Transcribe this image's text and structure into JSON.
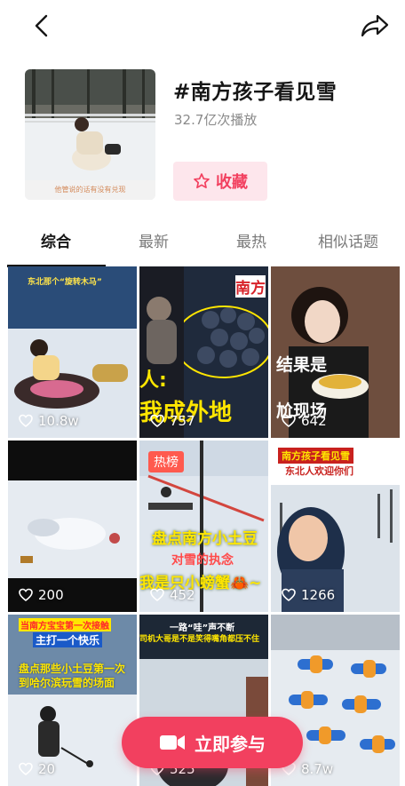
{
  "topic": {
    "title": "#南方孩子看见雪",
    "play_count": "32.7亿次播放",
    "cover_caption": "他管说的话有没有兑现",
    "favorite_label": "收藏"
  },
  "tabs": [
    "综合",
    "最新",
    "最热",
    "相似话题"
  ],
  "videos": [
    {
      "likes": "10.8w",
      "caption": "东北那个“旋转木马”"
    },
    {
      "likes": "757",
      "caption": "我成外地",
      "caption2": "人:",
      "caption3": "南方"
    },
    {
      "likes": "642",
      "caption": "结果是",
      "caption2": "尬现场"
    },
    {
      "likes": "200"
    },
    {
      "likes": "452",
      "caption": "盘点南方小土豆",
      "caption2": "对雪的执念",
      "caption3": "我是只小螃蟹🦀~",
      "tag": "热榜"
    },
    {
      "likes": "1266",
      "caption": "南方孩子看见雪",
      "caption2": "东北人欢迎你们"
    },
    {
      "likes": "20",
      "caption": "当南方宝宝第一次接触",
      "caption2": "主打一个快乐",
      "caption3": "盘点那些小土豆第一次",
      "caption4": "到哈尔滨玩雪的场面"
    },
    {
      "likes": "525",
      "caption": "一路“哇”声不断",
      "caption2": "司机大哥是不是笑得嘴角都压不住"
    },
    {
      "likes": "8.7w"
    }
  ],
  "join_button": {
    "label": "立即参与"
  }
}
